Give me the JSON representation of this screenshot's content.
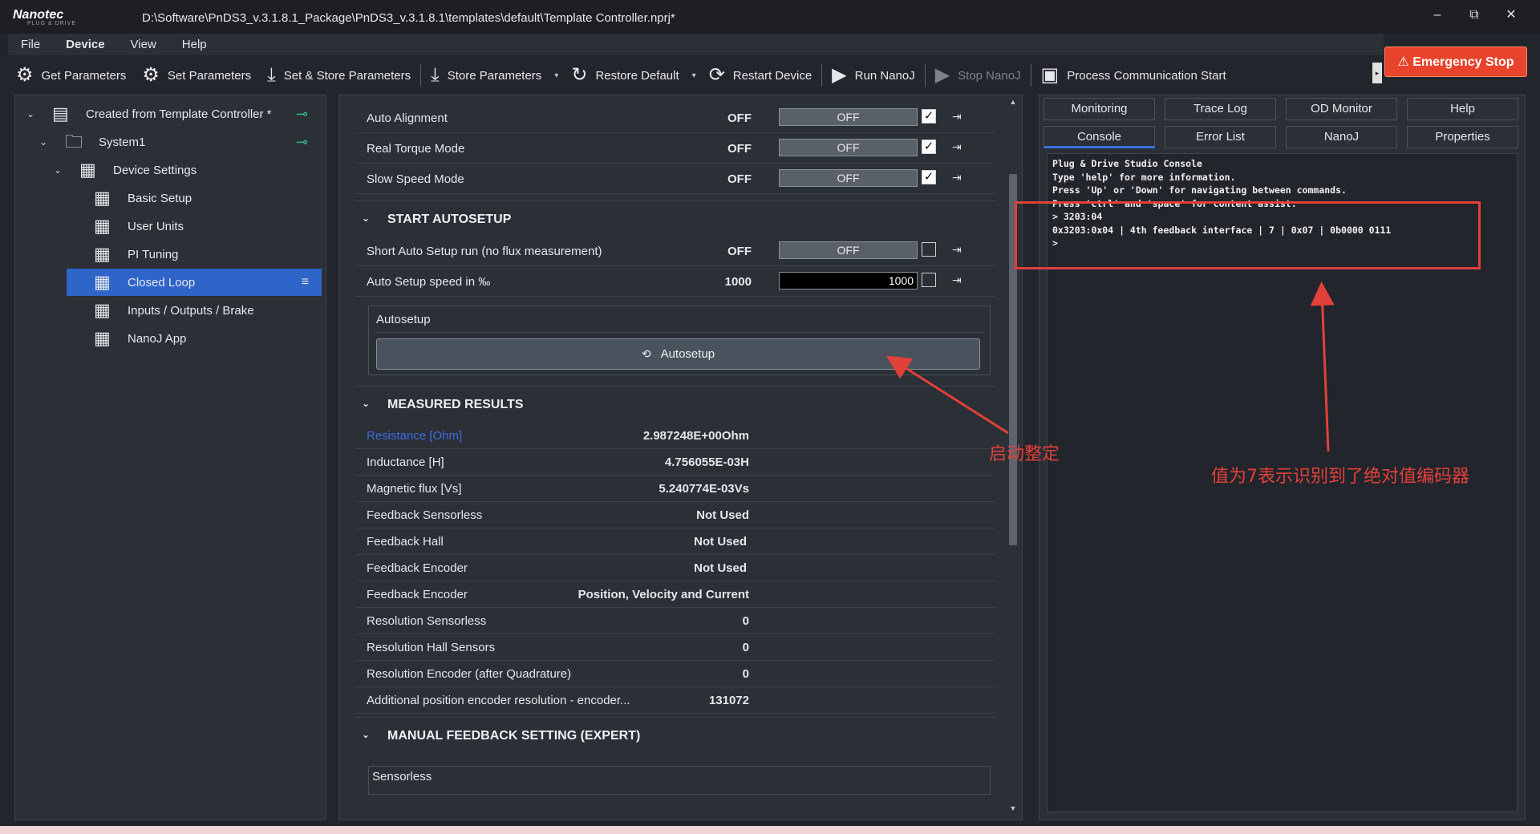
{
  "window": {
    "logo": "Nanotec",
    "logo_sub": "PLUG & DRIVE",
    "title": "D:\\Software\\PnDS3_v.3.1.8.1_Package\\PnDS3_v.3.1.8.1\\templates\\default\\Template Controller.nprj*",
    "min": "–",
    "restore": "⧉",
    "close": "✕"
  },
  "menu": [
    "File",
    "Device",
    "View",
    "Help"
  ],
  "toolbar": {
    "get_params": "Get Parameters",
    "set_params": "Set Parameters",
    "set_store": "Set & Store Parameters",
    "store": "Store Parameters",
    "restore_default": "Restore Default",
    "restart": "Restart Device",
    "run_nanoj": "Run NanoJ",
    "stop_nanoj": "Stop NanoJ",
    "process_comm": "Process Communication Start"
  },
  "emergency_stop": "⚠ Emergency Stop",
  "tree": {
    "root": "Created from Template Controller *",
    "system": "System1",
    "device_settings": "Device Settings",
    "items": [
      "Basic Setup",
      "User Units",
      "PI Tuning",
      "Closed Loop",
      "Inputs / Outputs / Brake",
      "NanoJ App"
    ]
  },
  "params_top": [
    {
      "label": "Auto Alignment",
      "value": "OFF",
      "field": "OFF"
    },
    {
      "label": "Real Torque Mode",
      "value": "OFF",
      "field": "OFF"
    },
    {
      "label": "Slow Speed Mode",
      "value": "OFF",
      "field": "OFF"
    }
  ],
  "sections": {
    "autosetup": "START AUTOSETUP",
    "measured": "MEASURED RESULTS",
    "manual": "MANUAL FEEDBACK SETTING (EXPERT)"
  },
  "autosetup_params": [
    {
      "label": "Short Auto Setup run (no flux measurement)",
      "value": "OFF",
      "field": "OFF"
    },
    {
      "label": "Auto Setup speed in ‰",
      "value": "1000",
      "field": "1000"
    }
  ],
  "autosetup_group": {
    "title": "Autosetup",
    "button": "Autosetup"
  },
  "measured": [
    {
      "label": "Resistance [Ohm]",
      "value": "2.987248E+00Ohm"
    },
    {
      "label": "Inductance [H]",
      "value": "4.756055E-03H"
    },
    {
      "label": "Magnetic flux [Vs]",
      "value": "5.240774E-03Vs"
    },
    {
      "label": "Feedback Sensorless",
      "value": "Not Used"
    },
    {
      "label": "Feedback Hall",
      "value": "Not Used"
    },
    {
      "label": "Feedback Encoder",
      "value": "Not Used"
    },
    {
      "label": "Feedback Encoder",
      "value": "Position, Velocity and Current"
    },
    {
      "label": "Resolution Sensorless",
      "value": "0"
    },
    {
      "label": "Resolution Hall Sensors",
      "value": "0"
    },
    {
      "label": "Resolution Encoder (after Quadrature)",
      "value": "0"
    },
    {
      "label": "Additional position encoder resolution - encoder...",
      "value": "131072"
    }
  ],
  "manual_group": {
    "title": "Sensorless"
  },
  "right_tabs": [
    "Monitoring",
    "Trace Log",
    "OD Monitor",
    "Help",
    "Console",
    "Error List",
    "NanoJ",
    "Properties"
  ],
  "console_lines": [
    "Plug & Drive Studio Console",
    "Type 'help' for more information.",
    "Press 'Up' or 'Down' for navigating between commands.",
    "Press 'ctrl' and 'space' for content assist.",
    "> 3203:04",
    "0x3203:0x04 | 4th feedback interface | 7 | 0x07 | 0b0000 0111",
    ">"
  ],
  "annotations": {
    "start_autosetup": "启动整定",
    "encoder_note": "值为7表示识别到了绝对值编码器"
  },
  "colors": {
    "accent": "#2f64c8",
    "estop": "#e8442b",
    "annotation": "#e2403a",
    "connected": "#2fc08a"
  }
}
